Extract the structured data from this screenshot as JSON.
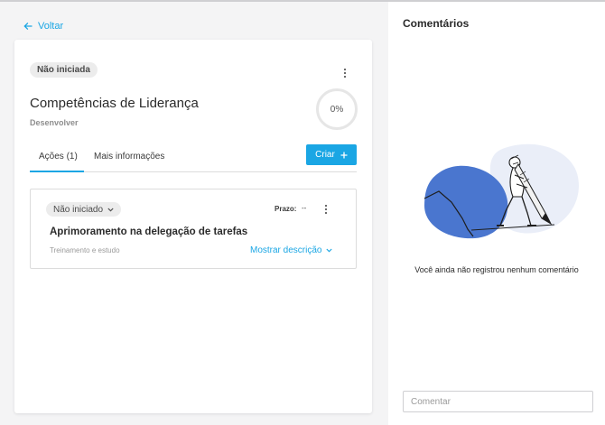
{
  "nav": {
    "back_label": "Voltar"
  },
  "goal": {
    "status": "Não iniciada",
    "title": "Competências de Liderança",
    "category": "Desenvolver",
    "progress_label": "0%"
  },
  "tabs": [
    {
      "label": "Ações (1)",
      "active": true
    },
    {
      "label": "Mais informações",
      "active": false
    }
  ],
  "create_button": {
    "label": "Criar",
    "icon": "plus-icon"
  },
  "action_item": {
    "status": "Não iniciado",
    "due_label": "Prazo:",
    "due_value": "--",
    "title": "Aprimoramento na delegação de tarefas",
    "type": "Treinamento e estudo",
    "show_description_label": "Mostrar descrição"
  },
  "comments": {
    "title": "Comentários",
    "empty_message": "Você ainda não registrou nenhum comentário",
    "input_placeholder": "Comentar"
  },
  "colors": {
    "accent": "#1aa6e4",
    "illustration_blob": "#4a76cf",
    "illustration_bg": "#eaeef8"
  }
}
